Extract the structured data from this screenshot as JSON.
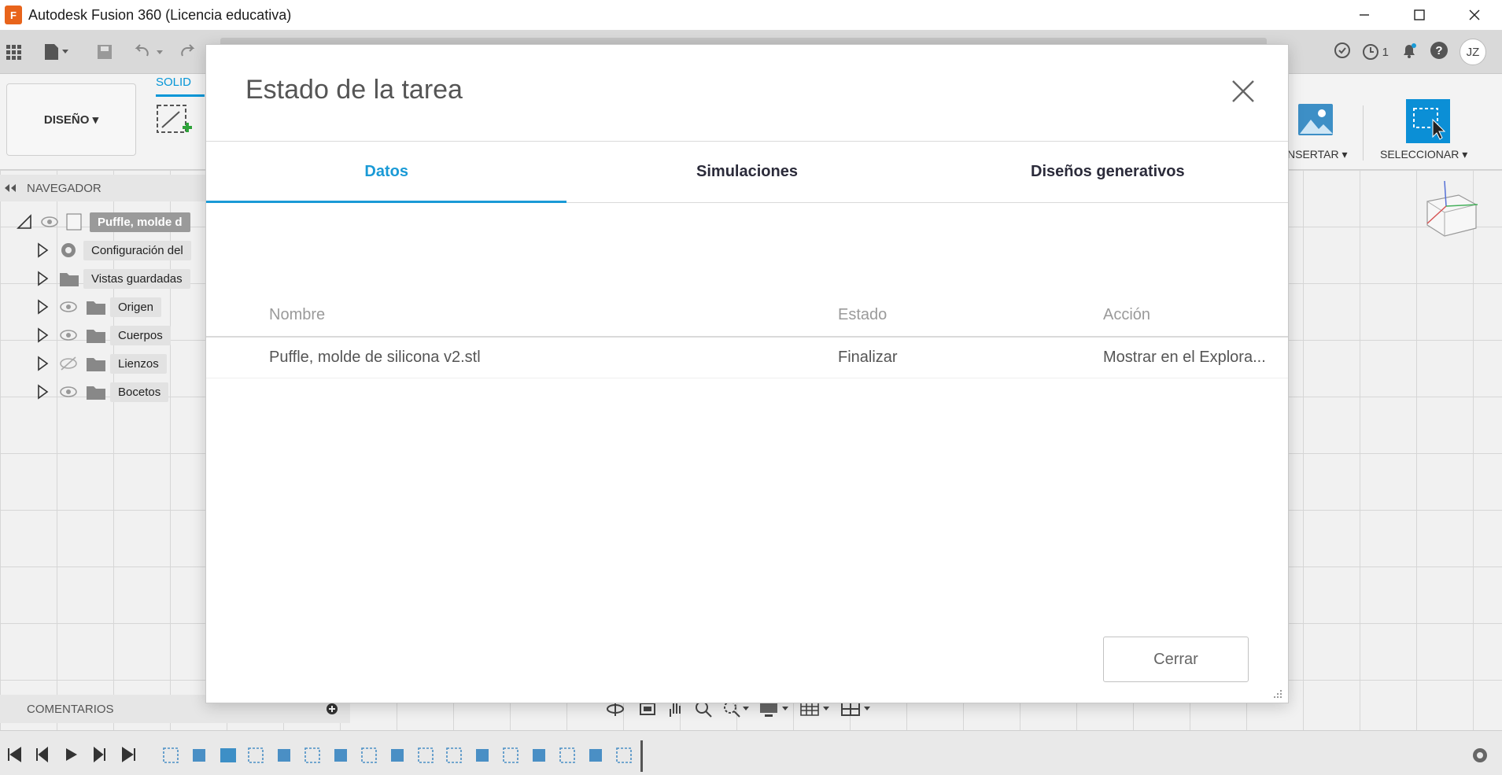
{
  "window": {
    "title": "Autodesk Fusion 360 (Licencia educativa)",
    "logo_letter": "F"
  },
  "toolbar": {
    "job_count": "1",
    "user_initials": "JZ"
  },
  "ribbon": {
    "workspace_label": "DISEÑO ▾",
    "active_tab": "SOLID",
    "insert_label": "NSERTAR ▾",
    "select_label": "SELECCIONAR ▾"
  },
  "navigator": {
    "label": "NAVEGADOR",
    "root": "Puffle, molde d",
    "items": [
      {
        "label": "Configuración del"
      },
      {
        "label": "Vistas guardadas"
      },
      {
        "label": "Origen"
      },
      {
        "label": "Cuerpos"
      },
      {
        "label": "Lienzos"
      },
      {
        "label": "Bocetos"
      }
    ]
  },
  "comments": {
    "label": "COMENTARIOS"
  },
  "dialog": {
    "title": "Estado de la tarea",
    "tabs": [
      {
        "label": "Datos",
        "active": true
      },
      {
        "label": "Simulaciones",
        "active": false
      },
      {
        "label": "Diseños generativos",
        "active": false
      }
    ],
    "columns": [
      "Nombre",
      "Estado",
      "Acción"
    ],
    "rows": [
      {
        "name": "Puffle, molde de silicona v2.stl",
        "status": "Finalizar",
        "action": "Mostrar en el Explora..."
      }
    ],
    "close_label": "Cerrar"
  },
  "colors": {
    "accent": "#1a9ad6",
    "brand_orange": "#e8641b"
  }
}
